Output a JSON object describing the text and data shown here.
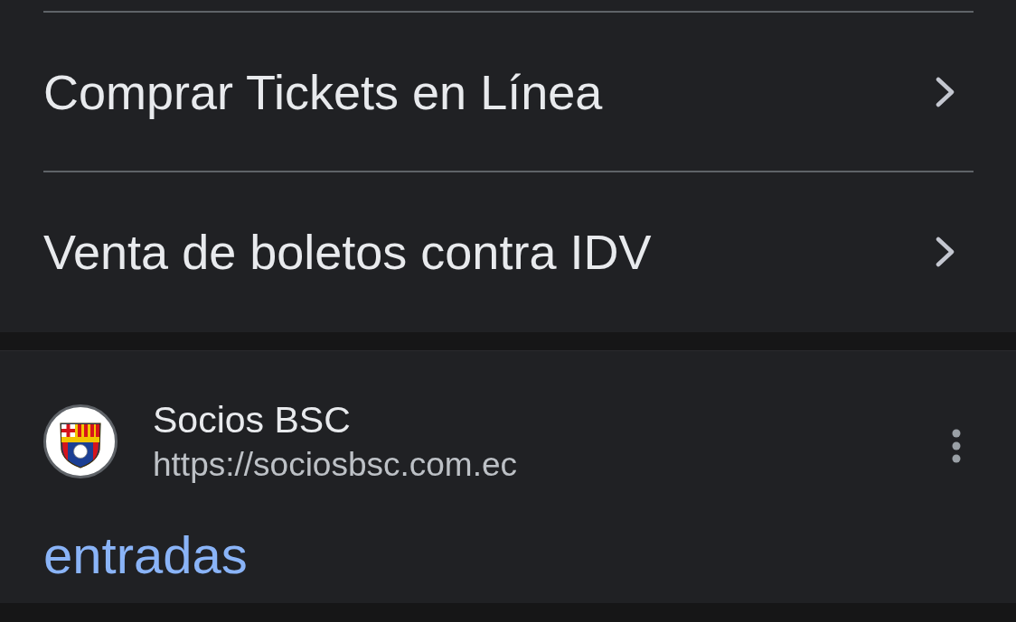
{
  "links": [
    {
      "label": "Comprar Tickets en Línea"
    },
    {
      "label": "Venta de boletos contra IDV"
    }
  ],
  "result": {
    "site_name": "Socios BSC",
    "url": "https://sociosbsc.com.ec",
    "title": "entradas"
  }
}
